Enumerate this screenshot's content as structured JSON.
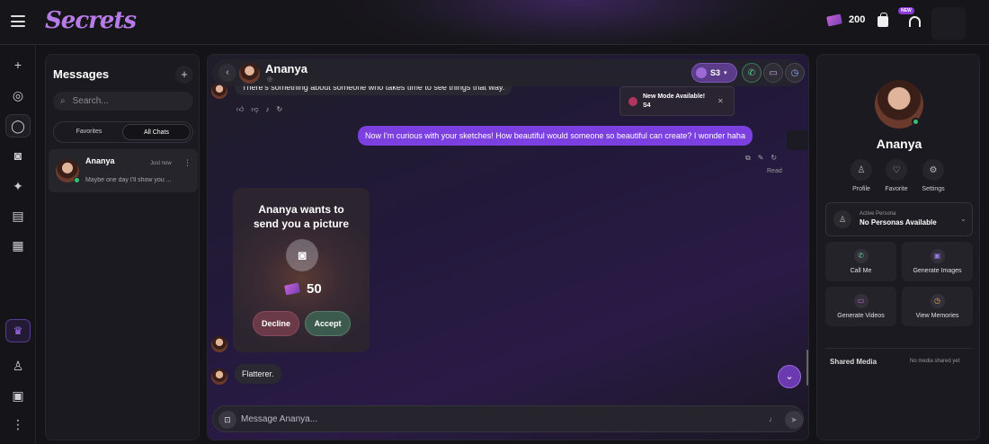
{
  "app": {
    "logo": "Secrets",
    "coins": "200",
    "new_badge": "NEW"
  },
  "sidebar": {
    "title": "Messages",
    "search_placeholder": "Search...",
    "tabs": [
      "Favorites",
      "All Chats"
    ],
    "chat": {
      "name": "Ananya",
      "time": "Just now",
      "preview": "Maybe one day I'll show you ..."
    }
  },
  "chat": {
    "name": "Ananya",
    "stars": "S3",
    "toast": {
      "title": "New Mode Available!",
      "sub": "S4"
    },
    "msg1": "There's something about someone who takes time to see things that way.",
    "msg2": "Now I'm curious with your sketches! How beautiful would someone so beautiful can create? I wonder haha",
    "read": "Read",
    "card": {
      "line1": "Ananya wants to",
      "line2": "send you a picture",
      "price": "50",
      "decline": "Decline",
      "accept": "Accept"
    },
    "msg3": "Flatterer.",
    "input_placeholder": "Message Ananya..."
  },
  "profile": {
    "name": "Ananya",
    "actions": [
      "Profile",
      "Favorite",
      "Settings"
    ],
    "persona_label": "Active Persona",
    "persona_value": "No Personas Available",
    "tiles": [
      "Call Me",
      "Generate Images",
      "Generate Videos",
      "View Memories"
    ],
    "shared_media": "Shared Media",
    "no_media": "No media shared yet"
  },
  "colors": {
    "accent": "#7c3fe0",
    "online": "#38c172"
  }
}
